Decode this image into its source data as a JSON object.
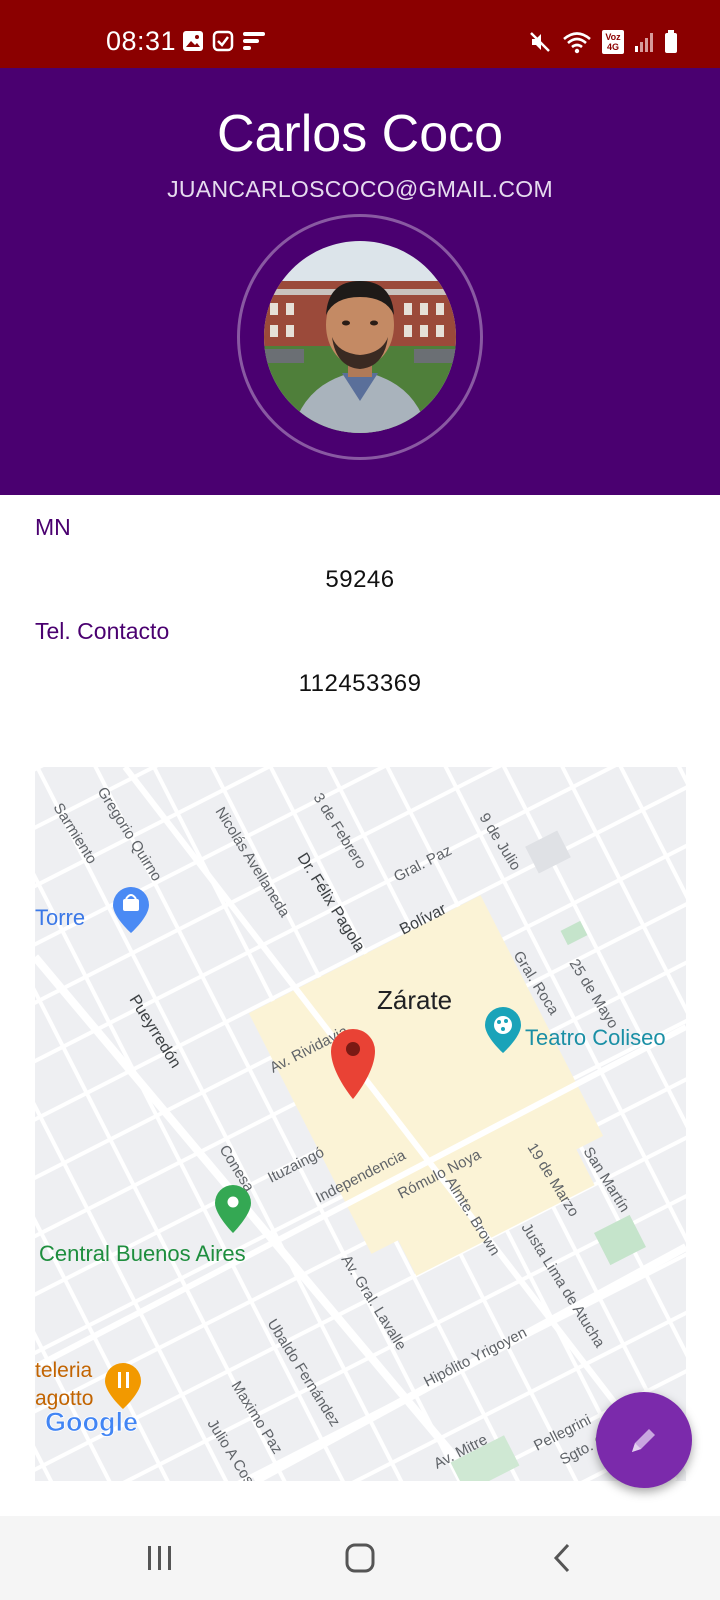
{
  "status_bar": {
    "time": "08:31",
    "left_icons": [
      "image-icon",
      "check-square-icon",
      "stack-icon"
    ],
    "right_icons": [
      "mute-icon",
      "wifi-icon",
      "volte-icon",
      "signal-icon",
      "battery-icon"
    ],
    "volte_label": "Voz 4G",
    "bg_color": "#8b0000"
  },
  "profile": {
    "name": "Carlos Coco",
    "email": "JUANCARLOSCOCO@GMAIL.COM",
    "header_color": "#4a0070"
  },
  "fields": [
    {
      "label": "MN",
      "value": "59246"
    },
    {
      "label": "Tel. Contacto",
      "value": "112453369"
    }
  ],
  "map": {
    "city_label": "Zárate",
    "places": [
      "Torre",
      "Teatro Coliseo",
      "Central Buenos Aires",
      "Google"
    ],
    "streets": [
      "Sarmiento",
      "Gregorio Quirno",
      "Nicolás Avellaneda",
      "3 de Febrero",
      "Dr. Félix Pagola",
      "Gral. Paz",
      "9 de Julio",
      "Bolívar",
      "Gral. Roca",
      "25 de Mayo",
      "Pueyrredón",
      "Av. Rividavia",
      "Ituzaingó",
      "Independencia",
      "Rómulo Noya",
      "19 de Marzo",
      "San Martín",
      "Conesa",
      "Almte. Brown",
      "Justa Lima de Atucha",
      "Av. Gral. Lavalle",
      "Hipólito Yrigoyen",
      "Ubaldo Fernández",
      "Maximo Paz",
      "Julio A Costa",
      "Av. Mitre",
      "Pellegrini",
      "Sgto. Ca"
    ],
    "restaurant_fragments": [
      "teleria",
      "agotto"
    ]
  },
  "fab": {
    "icon": "pencil-icon",
    "color": "#7b2aab"
  },
  "nav_bar": {
    "buttons": [
      "recents-icon",
      "home-icon",
      "back-icon"
    ]
  }
}
